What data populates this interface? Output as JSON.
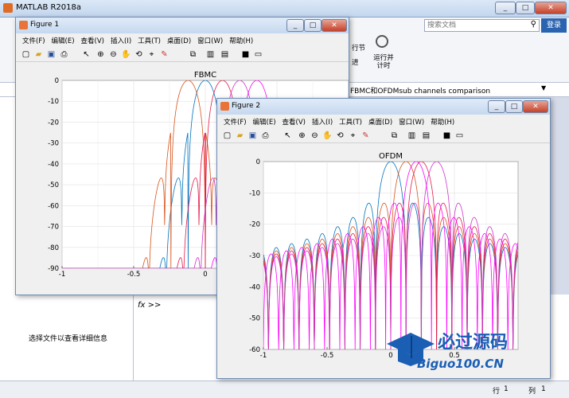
{
  "main": {
    "title": "MATLAB R2018a",
    "search_placeholder": "搜索文档",
    "login": "登录",
    "ribbon_btn1": "行节",
    "ribbon_btn2": "进",
    "ribbon_btn3": "运行并\n计时",
    "address_text": "FBMC和OFDMsub channels comparison",
    "left_panel_hint": "选择文件以查看详细信息",
    "cmd_prompt": "fx >>",
    "status_row_label": "行",
    "status_row_value": "1",
    "status_col_label": "列",
    "status_col_value": "1",
    "watermark_text": "必过源码",
    "watermark_sub": "Biguo100.CN"
  },
  "figure1": {
    "title": "Figure 1",
    "menus": [
      "文件(F)",
      "编辑(E)",
      "查看(V)",
      "插入(I)",
      "工具(T)",
      "桌面(D)",
      "窗口(W)",
      "帮助(H)"
    ]
  },
  "figure2": {
    "title": "Figure 2",
    "menus": [
      "文件(F)",
      "编辑(E)",
      "查看(V)",
      "插入(I)",
      "工具(T)",
      "桌面(D)",
      "窗口(W)",
      "帮助(H)"
    ]
  },
  "colors": {
    "s1": "#0072BD",
    "s2": "#D95319",
    "s3": "#E6194B",
    "s4": "#CC33CC",
    "s5": "#FF00FF"
  },
  "chart_data": [
    {
      "type": "line",
      "title": "FBMC",
      "xlim": [
        -1,
        1
      ],
      "ylim": [
        -90,
        0
      ],
      "xticks": [
        -1,
        -0.5,
        0,
        0.5
      ],
      "yticks": [
        0,
        -10,
        -20,
        -30,
        -40,
        -50,
        -60,
        -70,
        -80,
        -90
      ],
      "grid": true,
      "series": [
        {
          "center": 0.0
        },
        {
          "center": -0.12
        },
        {
          "center": 0.12
        },
        {
          "center": 0.24
        },
        {
          "center": 0.36
        }
      ]
    },
    {
      "type": "line",
      "title": "OFDM",
      "xlim": [
        -1,
        1
      ],
      "ylim": [
        -60,
        0
      ],
      "xticks": [
        -1,
        -0.5,
        0,
        0.5
      ],
      "yticks": [
        0,
        -10,
        -20,
        -30,
        -40,
        -50,
        -60
      ],
      "grid": true,
      "series": [
        {
          "center": 0.0
        },
        {
          "center": 0.12
        },
        {
          "center": 0.24
        },
        {
          "center": 0.36
        },
        {
          "center": 0.2
        }
      ]
    }
  ]
}
